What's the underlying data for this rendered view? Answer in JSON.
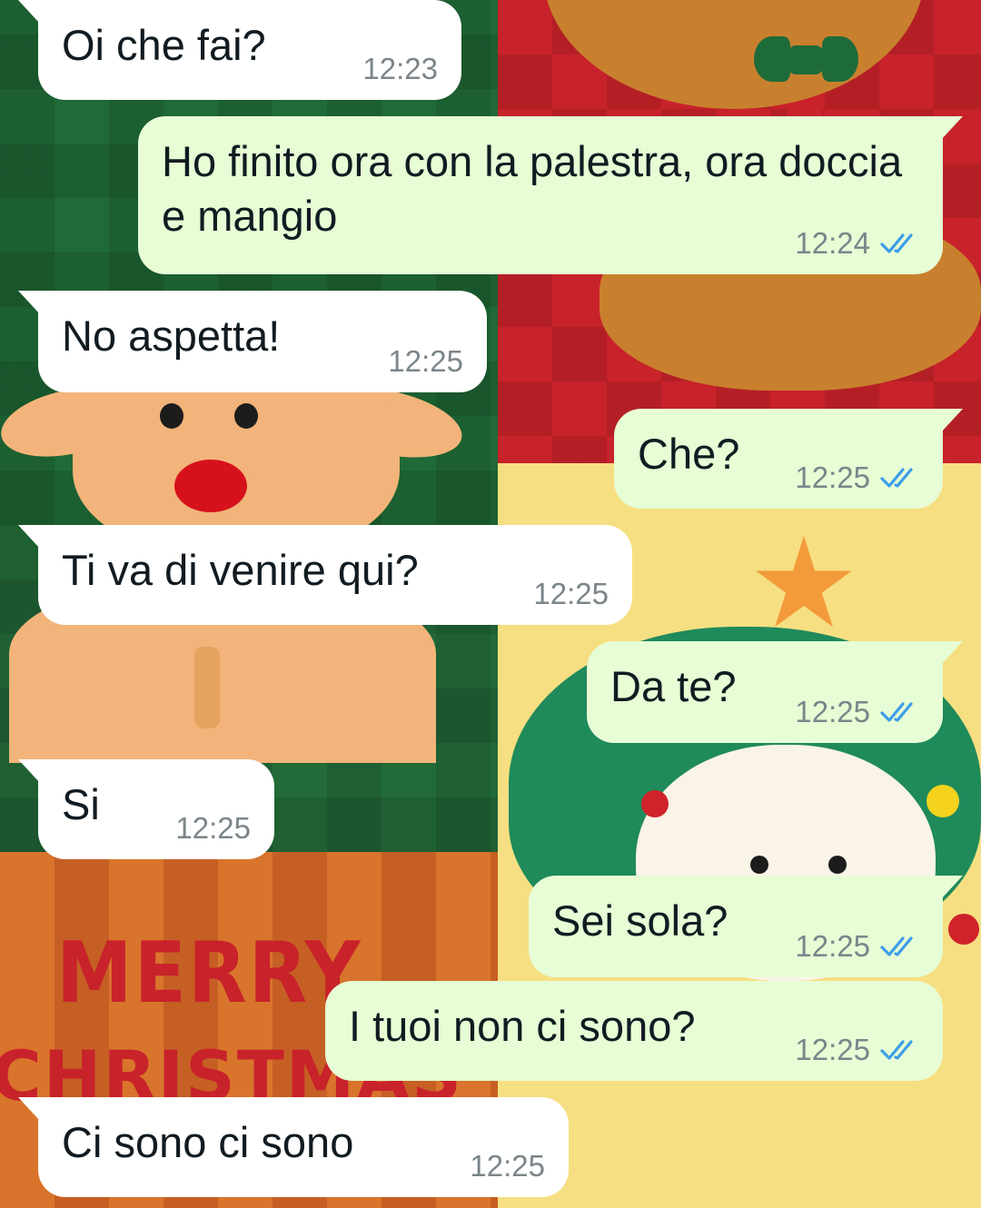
{
  "wallpaper": {
    "text_line1": "MERRY",
    "text_line2": "CHRISTMAS",
    "colors": {
      "green": "#1f6a36",
      "red": "#c8222a",
      "yellow": "#f6df82",
      "orange": "#d9742c"
    }
  },
  "chat": {
    "incoming_color": "#ffffff",
    "outgoing_color": "#e7fdd5",
    "read_tick_color": "#3b9ee8",
    "messages": [
      {
        "direction": "incoming",
        "text": "Oi che fai?",
        "time": "12:23"
      },
      {
        "direction": "outgoing",
        "text": "Ho finito ora con la palestra, ora doccia e mangio",
        "time": "12:24",
        "status": "read"
      },
      {
        "direction": "incoming",
        "text": "No aspetta!",
        "time": "12:25"
      },
      {
        "direction": "outgoing",
        "text": "Che?",
        "time": "12:25",
        "status": "read"
      },
      {
        "direction": "incoming",
        "text": "Ti va di venire qui?",
        "time": "12:25"
      },
      {
        "direction": "outgoing",
        "text": "Da te?",
        "time": "12:25",
        "status": "read"
      },
      {
        "direction": "incoming",
        "text": "Si",
        "time": "12:25"
      },
      {
        "direction": "outgoing",
        "text": "Sei sola?",
        "time": "12:25",
        "status": "read"
      },
      {
        "direction": "outgoing",
        "text": "I tuoi non ci sono?",
        "time": "12:25",
        "status": "read"
      },
      {
        "direction": "incoming",
        "text": "Ci sono ci sono",
        "time": "12:25"
      }
    ]
  }
}
